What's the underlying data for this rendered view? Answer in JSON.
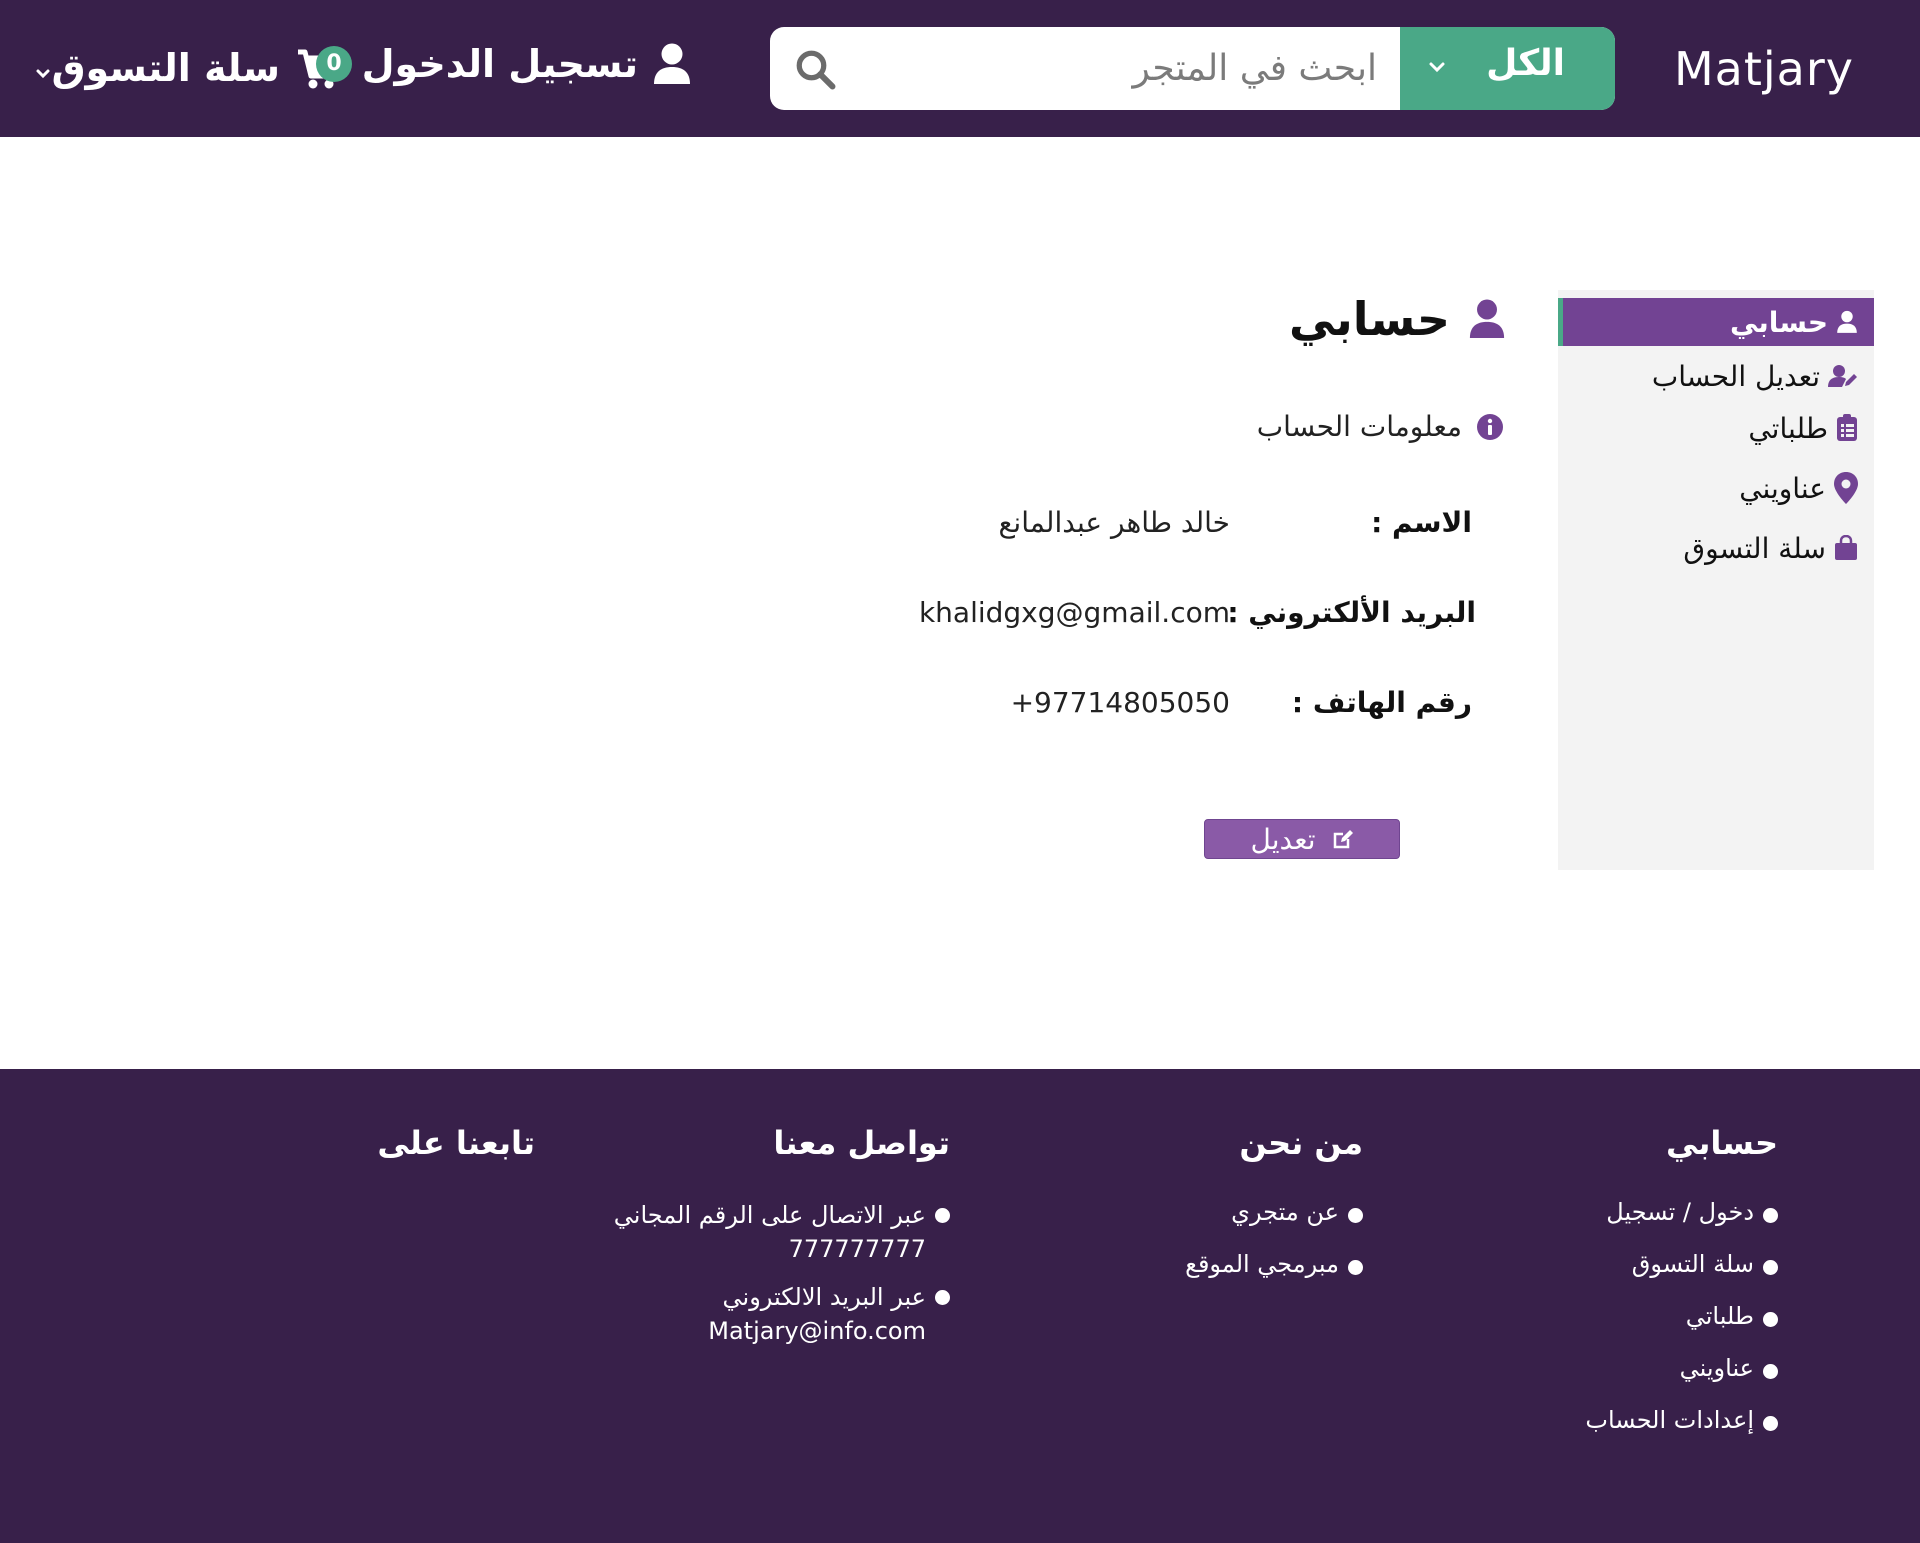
{
  "header": {
    "brand": "Matjary",
    "category_label": "الكل",
    "search_placeholder": "ابحث في المتجر",
    "login_label": "تسجيل الدخول",
    "cart_label": "سلة التسوق",
    "cart_count": "0"
  },
  "sidebar": {
    "items": [
      {
        "label": "حسابي",
        "icon": "user-icon",
        "active": true
      },
      {
        "label": "تعديل الحساب",
        "icon": "user-edit-icon"
      },
      {
        "label": "طلباتي",
        "icon": "clipboard-list-icon"
      },
      {
        "label": "عناويني",
        "icon": "map-pin-icon"
      },
      {
        "label": "سلة التسوق",
        "icon": "shopping-bag-icon"
      }
    ]
  },
  "main": {
    "title": "حسابي",
    "section_title": "معلومات الحساب",
    "fields": [
      {
        "label": "الاسم :",
        "value": "خالد طاهر عبدالمانع"
      },
      {
        "label": "البريد الألكتروني :",
        "value": "khalidgxg@gmail.com"
      },
      {
        "label": "رقم الهاتف :",
        "value": "+97714805050"
      }
    ],
    "edit_label": "تعديل"
  },
  "footer": {
    "account": {
      "title": "حسابي",
      "links": [
        "دخول / تسجيل",
        "سلة التسوق",
        "طلباتي",
        "عناويني",
        "إعدادات الحساب"
      ]
    },
    "about": {
      "title": "من نحن",
      "links": [
        "عن متجري",
        "مبرمجي الموقع"
      ]
    },
    "contact": {
      "title": "تواصل معنا",
      "phone_label": "عبر الاتصال على الرقم المجاني",
      "phone": "777777777",
      "email_label": "عبر البريد الالكتروني",
      "email": "Matjary@info.com"
    },
    "follow": {
      "title": "تابعنا على"
    }
  },
  "colors": {
    "header_bg": "#38204a",
    "accent_green": "#4aa887",
    "accent_purple": "#724393",
    "button_purple": "#8a5aa7"
  }
}
